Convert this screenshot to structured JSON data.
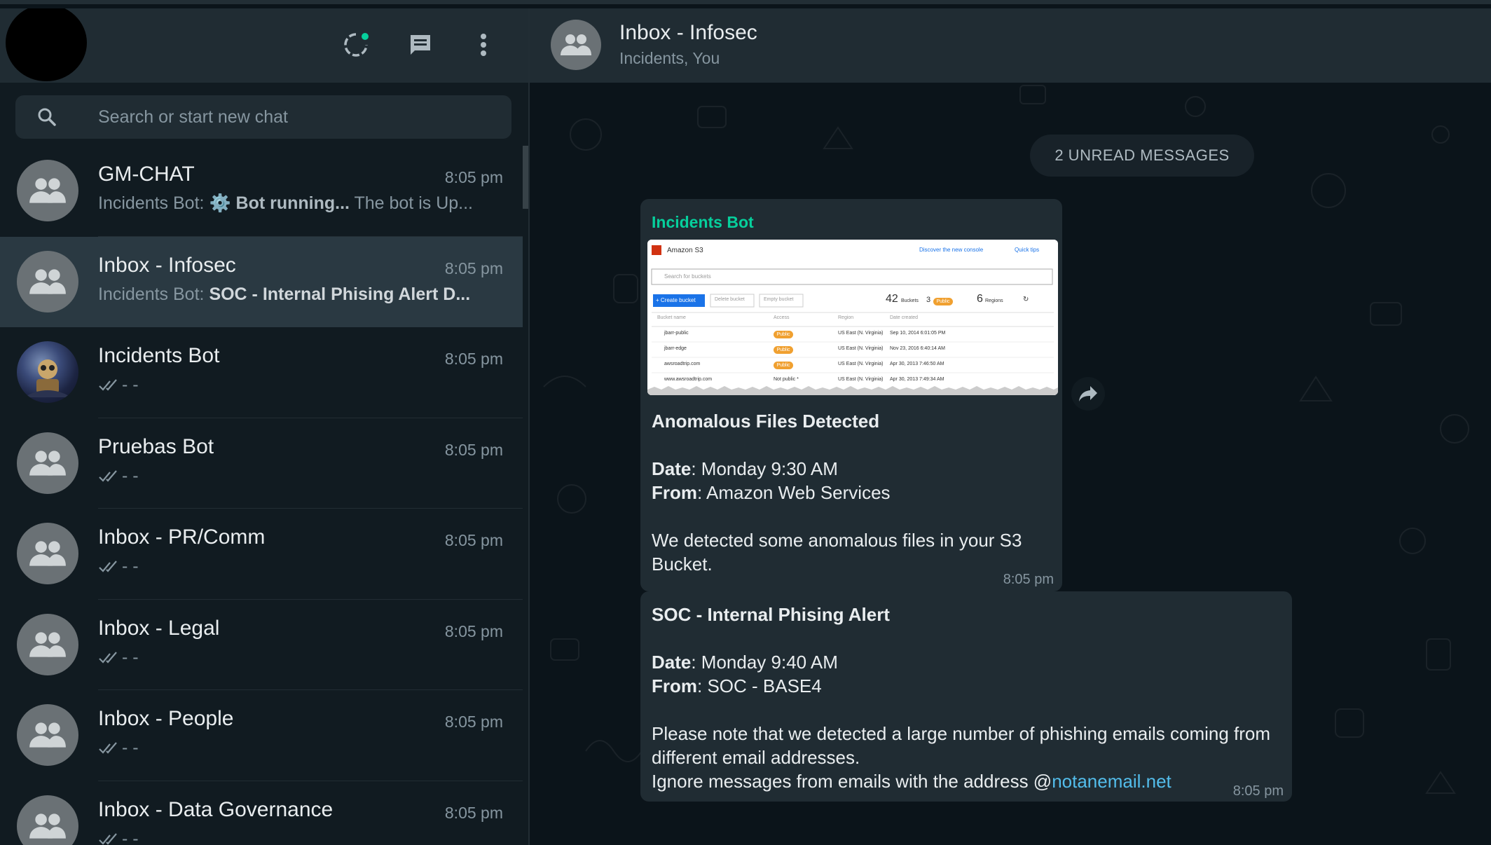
{
  "left": {
    "header": {
      "icons": [
        "status-icon",
        "new-chat-icon",
        "menu-icon"
      ]
    },
    "search": {
      "placeholder": "Search or start new chat"
    },
    "chats": [
      {
        "name": "GM-CHAT",
        "time": "8:05 pm",
        "preview_sender": "Incidents Bot: ",
        "preview_bold": "⚙️ Bot running...",
        "preview_rest": " The bot is Up...",
        "active": false,
        "ticks": false
      },
      {
        "name": "Inbox - Infosec",
        "time": "8:05 pm",
        "preview_sender": "Incidents Bot: ",
        "preview_bold": "SOC - Internal Phising Alert D...",
        "preview_rest": "",
        "active": true,
        "ticks": false
      },
      {
        "name": "Incidents Bot",
        "time": "8:05 pm",
        "preview_sender": "",
        "preview_bold": "",
        "preview_rest": "- -",
        "active": false,
        "ticks": true
      },
      {
        "name": "Pruebas Bot",
        "time": "8:05 pm",
        "preview_sender": "",
        "preview_bold": "",
        "preview_rest": "- -",
        "active": false,
        "ticks": true
      },
      {
        "name": "Inbox - PR/Comm",
        "time": "8:05 pm",
        "preview_sender": "",
        "preview_bold": "",
        "preview_rest": "- -",
        "active": false,
        "ticks": true
      },
      {
        "name": "Inbox - Legal",
        "time": "8:05 pm",
        "preview_sender": "",
        "preview_bold": "",
        "preview_rest": "- -",
        "active": false,
        "ticks": true
      },
      {
        "name": "Inbox - People",
        "time": "8:05 pm",
        "preview_sender": "",
        "preview_bold": "",
        "preview_rest": "- -",
        "active": false,
        "ticks": true
      },
      {
        "name": "Inbox - Data Governance",
        "time": "8:05 pm",
        "preview_sender": "",
        "preview_bold": "",
        "preview_rest": "- -",
        "active": false,
        "ticks": true
      }
    ]
  },
  "conversation": {
    "title": "Inbox - Infosec",
    "subtitle": "Incidents, You",
    "unread": "2 UNREAD MESSAGES",
    "message1": {
      "sender": "Incidents Bot",
      "heading": "Anomalous Files Detected",
      "date_label": "Date",
      "date_value": ": Monday 9:30 AM",
      "from_label": "From",
      "from_value": ": Amazon Web Services",
      "body": "We detected some anomalous files in your S3 Bucket.",
      "time": "8:05 pm",
      "screenshot": {
        "service": "Amazon S3",
        "discover": "Discover the new console",
        "quick_tips": "Quick tips",
        "search_placeholder": "Search for buckets",
        "create": "+ Create bucket",
        "delete": "Delete bucket",
        "empty": "Empty bucket",
        "buckets_count": "42",
        "buckets_label": "Buckets",
        "public_count": "3",
        "public_label": "Public",
        "regions_count": "6",
        "regions_label": "Regions",
        "columns": [
          "Bucket name",
          "Access",
          "Region",
          "Date created"
        ],
        "rows": [
          {
            "name": "jbarr-public",
            "access": "Public",
            "region": "US East (N. Virginia)",
            "date": "Sep 10, 2014 6:01:05 PM"
          },
          {
            "name": "jbarr-edge",
            "access": "Public",
            "region": "US East (N. Virginia)",
            "date": "Nov 23, 2016 6:40:14 AM"
          },
          {
            "name": "awsroadtrip.com",
            "access": "Public",
            "region": "US East (N. Virginia)",
            "date": "Apr 30, 2013 7:46:50 AM"
          },
          {
            "name": "www.awsroadtrip.com",
            "access": "Not public *",
            "region": "US East (N. Virginia)",
            "date": "Apr 30, 2013 7:49:34 AM"
          }
        ]
      }
    },
    "message2": {
      "heading": "SOC - Internal Phising Alert",
      "date_label": "Date",
      "date_value": ": Monday 9:40 AM",
      "from_label": "From",
      "from_value": ": SOC - BASE4",
      "body": "Please note that we detected a large number of phishing emails coming from different email addresses.",
      "ignore_text": "Ignore messages from emails with the address @",
      "link": "notanemail.net",
      "time": "8:05 pm"
    }
  },
  "colors": {
    "accent": "#06cf9c",
    "link": "#53bdeb",
    "bubble": "#202c33",
    "panel": "#111b21",
    "header": "#202c33"
  }
}
